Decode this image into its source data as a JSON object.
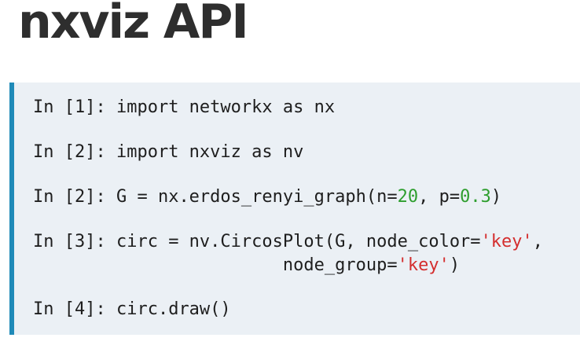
{
  "title": "nxviz API",
  "colors": {
    "accent_bar": "#1f8ab8",
    "code_background": "#ebf0f5",
    "number": "#2e9e2e",
    "string": "#d42e2e"
  },
  "cells": [
    {
      "prompt": "In [1]: ",
      "code": "import networkx as nx"
    },
    {
      "prompt": "In [2]: ",
      "code": "import nxviz as nv"
    },
    {
      "prompt": "In [2]: ",
      "code_start": "G = nx.erdos_renyi_graph(n=",
      "n_value": "20",
      "code_mid": ", p=",
      "p_value": "0.3",
      "code_end": ")"
    },
    {
      "prompt": "In [3]: ",
      "code_start": "circ = nv.CircosPlot(G, node_color=",
      "node_color_value": "'key'",
      "code_end": ",",
      "continuation_indent": "                        ",
      "continuation_start": "node_group=",
      "node_group_value": "'key'",
      "continuation_end": ")"
    },
    {
      "prompt": "In [4]: ",
      "code": "circ.draw()"
    }
  ]
}
